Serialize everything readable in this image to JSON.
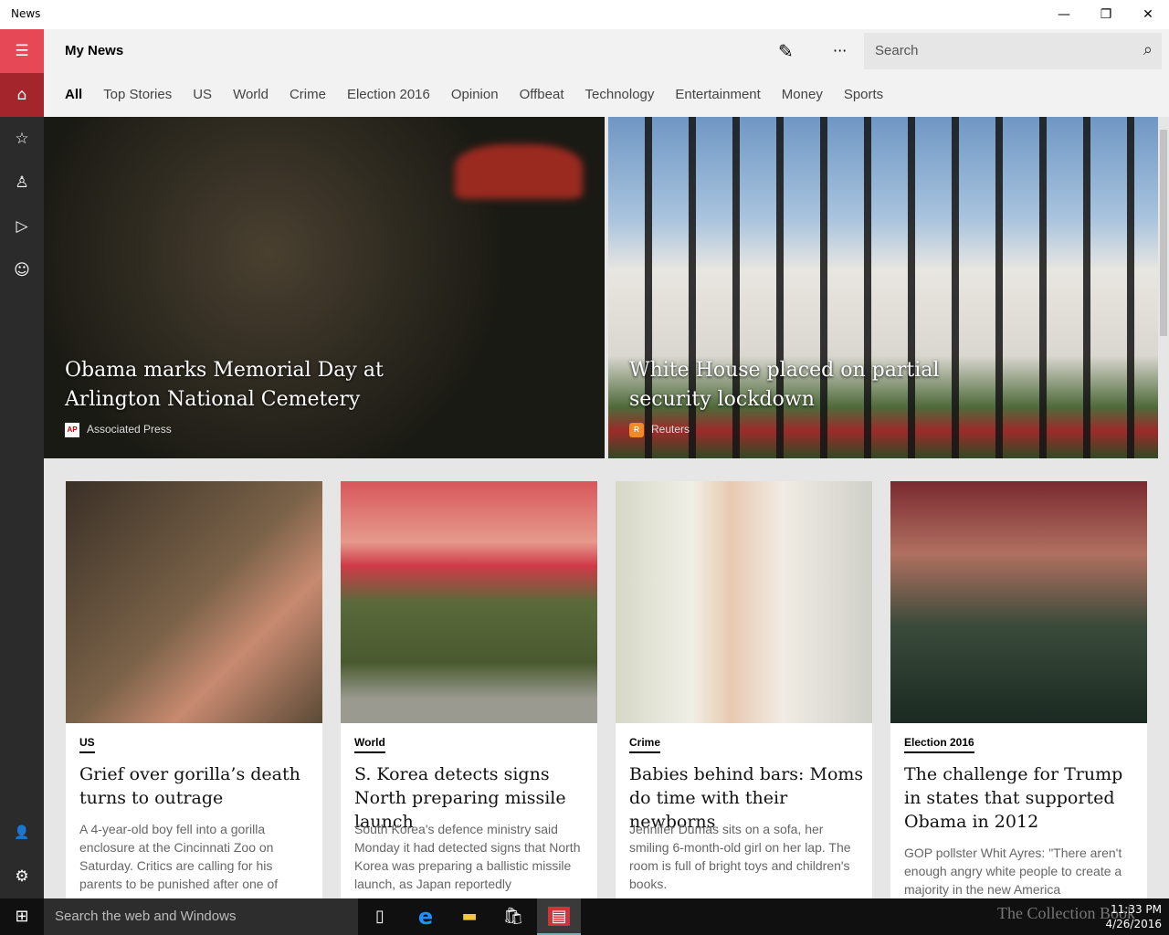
{
  "window": {
    "title": "News",
    "minimize": "—",
    "restore": "❐",
    "close": "✕"
  },
  "sidebar": {
    "menu": "☰",
    "home": "⌂",
    "favorites": "☆",
    "local": "♙",
    "video": "▷",
    "feedback": "☺",
    "account": "👤",
    "settings": "⚙"
  },
  "header": {
    "title": "My News",
    "edit_icon": "✎",
    "more_icon": "···",
    "search_placeholder": "Search",
    "search_icon": "⌕"
  },
  "tabs": [
    "All",
    "Top Stories",
    "US",
    "World",
    "Crime",
    "Election 2016",
    "Opinion",
    "Offbeat",
    "Technology",
    "Entertainment",
    "Money",
    "Sports"
  ],
  "heroes": [
    {
      "headline": "Obama marks Memorial Day at Arlington National Cemetery",
      "source": "Associated Press",
      "logo": "AP"
    },
    {
      "headline": "White House placed on partial security lockdown",
      "source": "Reuters",
      "logo": "R"
    }
  ],
  "cards": [
    {
      "category": "US",
      "headline": "Grief over gorilla’s death turns to outrage",
      "summary": "A 4-year-old boy fell into a gorilla enclosure at the Cincinnati Zoo on Saturday. Critics are calling for his parents to be punished after one of"
    },
    {
      "category": "World",
      "headline": "S. Korea detects signs North preparing missile launch",
      "summary": "South Korea's defence ministry said Monday it had detected signs that North Korea was preparing a ballistic missile launch, as Japan reportedly"
    },
    {
      "category": "Crime",
      "headline": "Babies behind bars: Moms do time with their newborns",
      "summary": "Jennifer Dumas sits on a sofa, her smiling 6-month-old girl on her lap. The room is full of bright toys and children's books."
    },
    {
      "category": "Election 2016",
      "headline": "The challenge for Trump in states that supported Obama in 2012",
      "summary": "GOP pollster Whit Ayres: \"There aren't enough angry white people to create a majority in the new America"
    }
  ],
  "taskbar": {
    "start": "⊞",
    "search_placeholder": "Search the web and Windows",
    "task_view": "▯",
    "edge": "e",
    "explorer": "▬",
    "store": "🛍",
    "news": "▤",
    "time": "11:33 PM",
    "date": "4/26/2016",
    "watermark": "The Collection Book"
  },
  "colors": {
    "accent": "#e74856",
    "accent_dark": "#a4262c",
    "sidebar": "#2b2b2b"
  }
}
